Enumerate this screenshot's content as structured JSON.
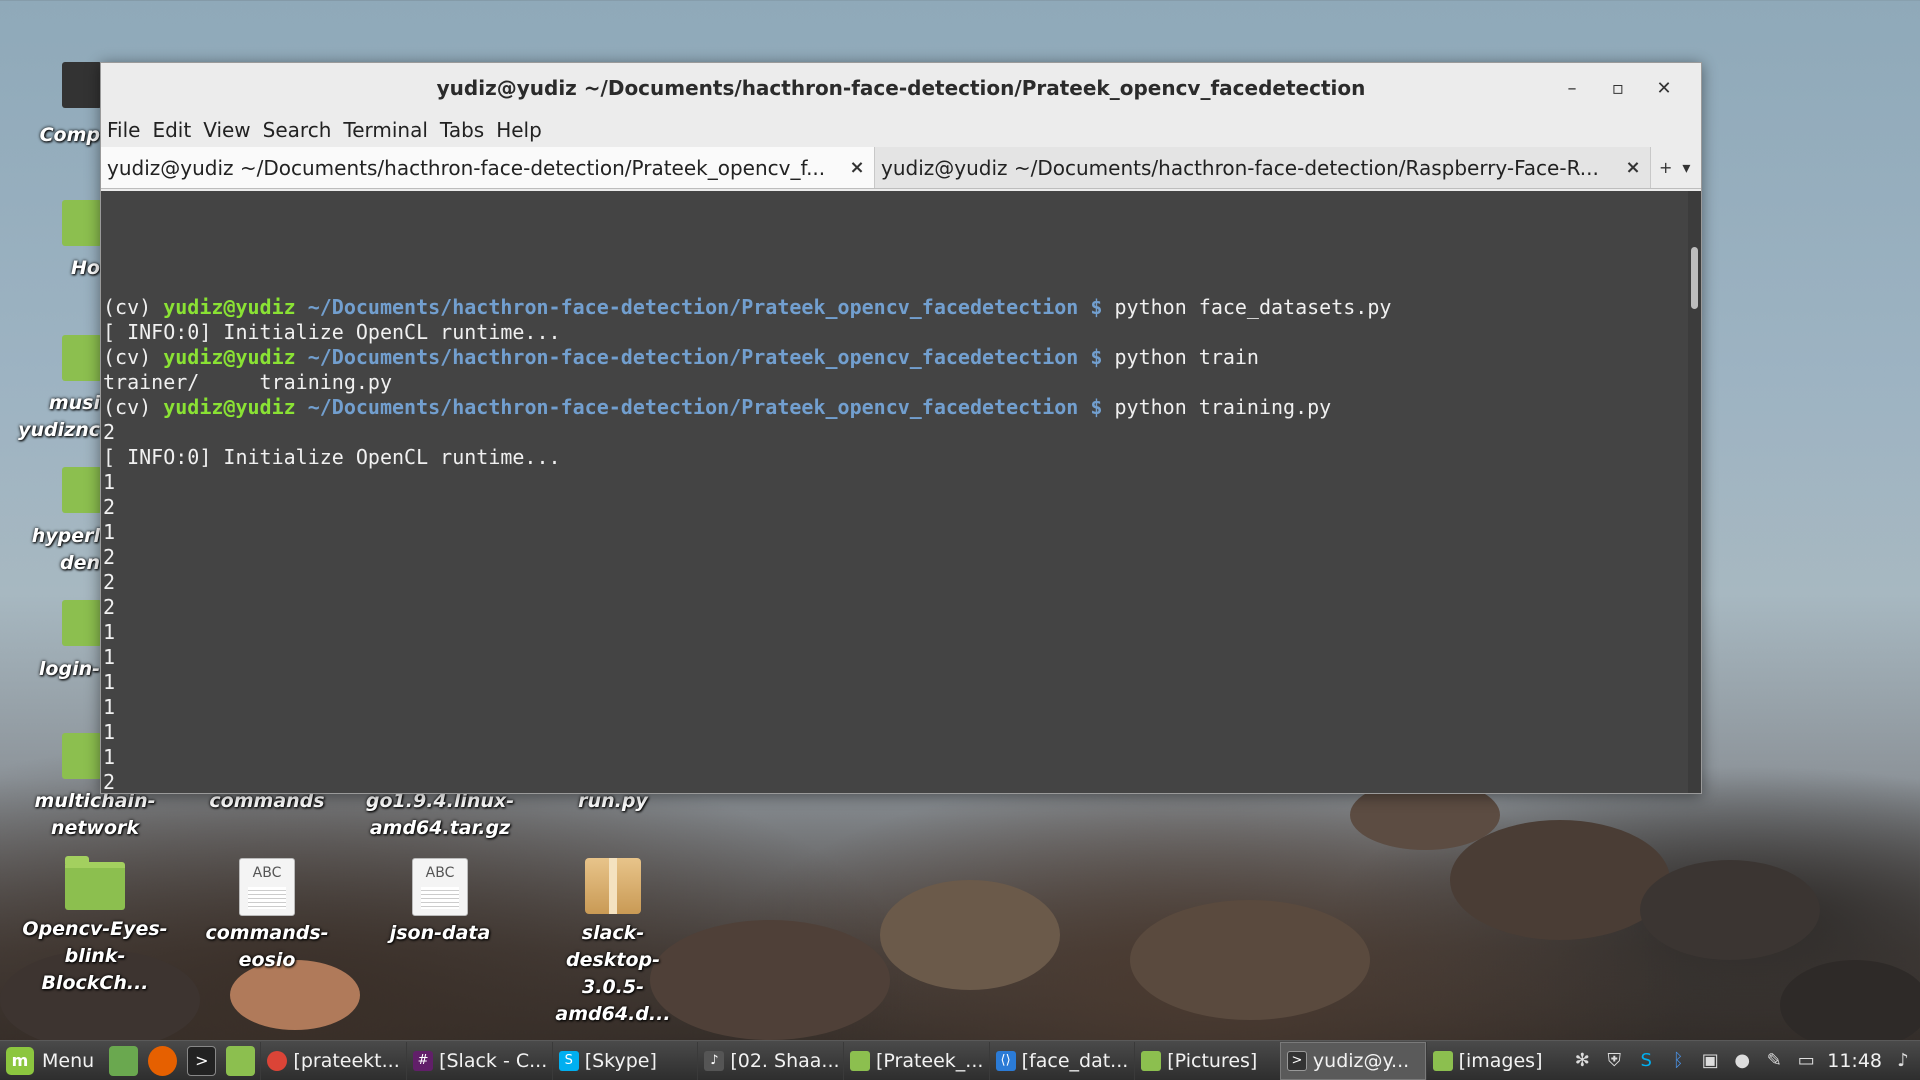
{
  "window": {
    "title": "yudiz@yudiz ~/Documents/hacthron-face-detection/Prateek_opencv_facedetection",
    "controls": {
      "minimize": "–",
      "maximize": "▫",
      "close": "✕"
    }
  },
  "menubar": [
    "File",
    "Edit",
    "View",
    "Search",
    "Terminal",
    "Tabs",
    "Help"
  ],
  "tabs": [
    {
      "label": "yudiz@yudiz ~/Documents/hacthron-face-detection/Prateek_opencv_f...",
      "close": "×"
    },
    {
      "label": "yudiz@yudiz ~/Documents/hacthron-face-detection/Raspberry-Face-R...",
      "close": "×"
    }
  ],
  "tab_tools": {
    "new_tab": "+",
    "dropdown": "▾"
  },
  "terminal": {
    "env": "(cv)",
    "user": "yudiz@yudiz",
    "path": "~/Documents/hacthron-face-detection/Prateek_opencv_facedetection",
    "sign": "$",
    "cmd1": "python face_datasets.py",
    "out1": "[ INFO:0] Initialize OpenCL runtime...",
    "cmd2": "python train",
    "out2": "trainer/     training.py",
    "cmd3": "python training.py",
    "out3": "2",
    "out4": "[ INFO:0] Initialize OpenCL runtime...",
    "numbers": [
      "1",
      "2",
      "1",
      "2",
      "2",
      "2",
      "1",
      "1",
      "1",
      "1",
      "1",
      "1",
      "2"
    ]
  },
  "desktop": {
    "icons": [
      {
        "label": "Comp"
      },
      {
        "label": "Ho"
      },
      {
        "label": "musi"
      },
      {
        "label": "yudiznc"
      },
      {
        "label": "hyperl"
      },
      {
        "label": "den"
      },
      {
        "label": "login-"
      },
      {
        "label": "multichain-network"
      },
      {
        "label": "commands"
      },
      {
        "label": "go1.9.4.linux-amd64.tar.gz"
      },
      {
        "label": "run.py"
      },
      {
        "label": "Opencv-Eyes-blink-BlockCh..."
      },
      {
        "label": "commands-eosio"
      },
      {
        "label": "json-data"
      },
      {
        "label": "slack-desktop-3.0.5-amd64.d..."
      }
    ],
    "doc_badge": "ABC"
  },
  "taskbar": {
    "menu_label": "Menu",
    "tasks": [
      {
        "label": "[prateekt...",
        "icon": "chrome-icon",
        "color": "#db4437"
      },
      {
        "label": "[Slack - C...",
        "icon": "slack-icon",
        "color": "#611f69"
      },
      {
        "label": "[Skype]",
        "icon": "skype-icon",
        "color": "#00aff0"
      },
      {
        "label": "[02. Shaa...",
        "icon": "media-player-icon",
        "color": "#555555"
      },
      {
        "label": "[Prateek_...",
        "icon": "folder-icon",
        "color": "#8cbf4f"
      },
      {
        "label": "[face_dat...",
        "icon": "vscode-icon",
        "color": "#2b7bd6"
      },
      {
        "label": "[Pictures]",
        "icon": "folder-icon",
        "color": "#8cbf4f"
      },
      {
        "label": "yudiz@y...",
        "icon": "terminal-icon",
        "color": "#333333"
      },
      {
        "label": "[images]",
        "icon": "folder-icon",
        "color": "#8cbf4f"
      }
    ],
    "clock": "11:48"
  }
}
